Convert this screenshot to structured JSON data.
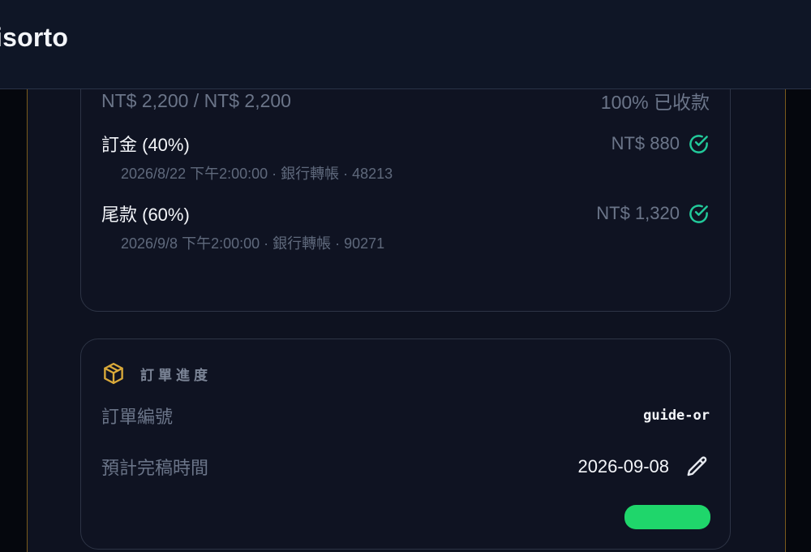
{
  "app": {
    "title": "isorto"
  },
  "payment": {
    "summary_amount": "NT$ 2,200 / NT$ 2,200",
    "summary_status": "100% 已收款",
    "items": [
      {
        "label": "訂金 (40%)",
        "amount": "NT$ 880",
        "detail": "2026/8/22 下午2:00:00 · 銀行轉帳 · 48213",
        "icon": "check-circle-icon"
      },
      {
        "label": "尾款 (60%)",
        "amount": "NT$ 1,320",
        "detail": "2026/9/8 下午2:00:00 · 銀行轉帳 · 90271",
        "icon": "check-circle-icon"
      }
    ]
  },
  "progress": {
    "title": "訂單進度",
    "icon": "package-icon",
    "order_no_label": "訂單編號",
    "order_no_value": "guide-or",
    "due_label": "預計完稿時間",
    "due_value": "2026-09-08",
    "edit_icon": "pencil-icon"
  },
  "colors": {
    "accent_gold": "#d9a93a",
    "success_green": "#1fd66b",
    "check_teal": "#22c99a",
    "background": "#0e1220"
  }
}
